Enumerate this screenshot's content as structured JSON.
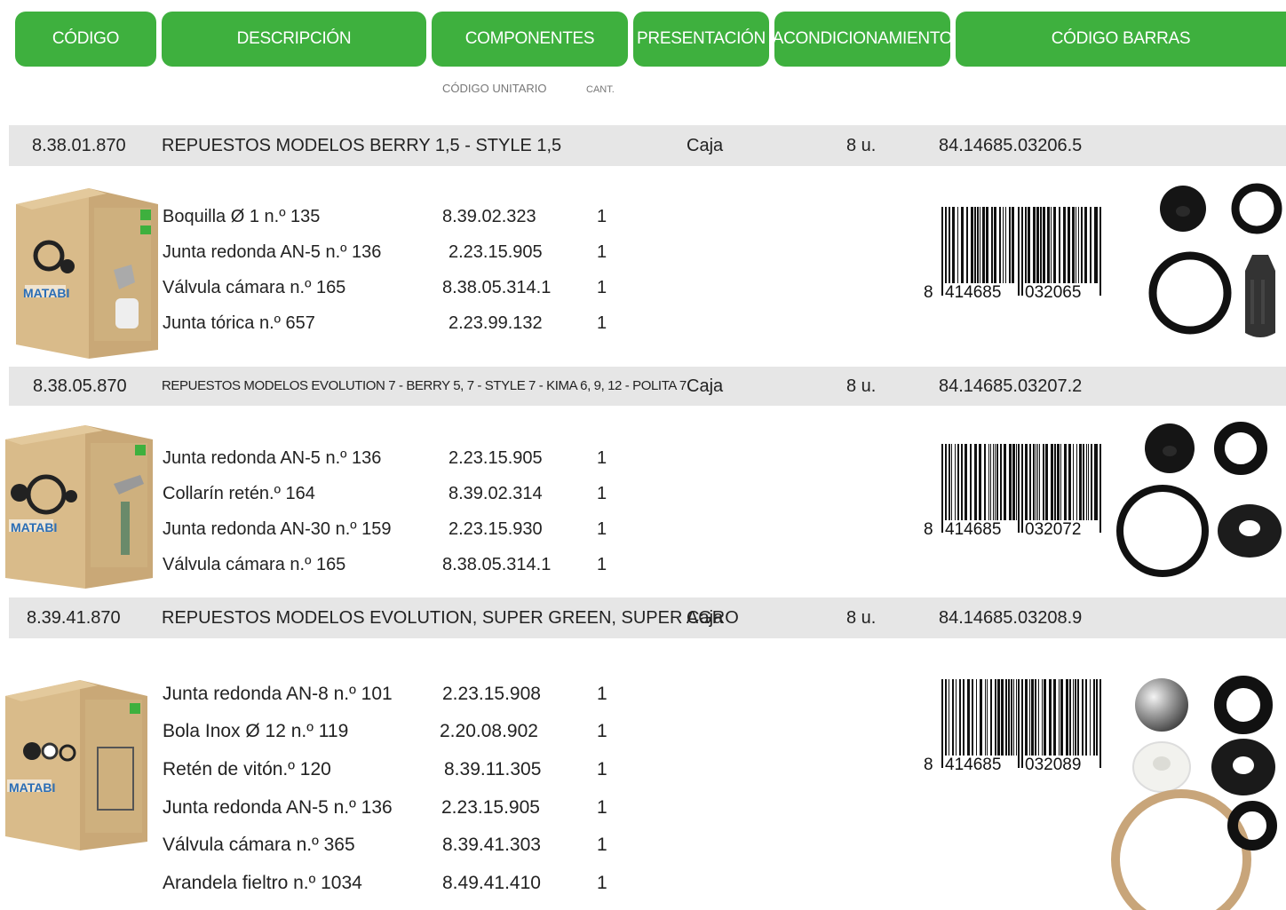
{
  "headers": {
    "codigo": "CÓDIGO",
    "descripcion": "DESCRIPCIÓN",
    "componentes": "COMPONENTES",
    "presentacion": "PRESENTACIÓN",
    "acondicionamiento": "ACONDICIONAMIENTO",
    "codigo_barras": "CÓDIGO BARRAS",
    "codigo_unitario": "CÓDIGO UNITARIO",
    "cant": "CANT."
  },
  "colors": {
    "accent": "#3eb03e",
    "band": "#e6e6e6",
    "box": "#c9a877"
  },
  "products": [
    {
      "code": "8.38.01.870",
      "description": "REPUESTOS MODELOS BERRY 1,5 - STYLE 1,5",
      "presentation": "Caja",
      "pack": "8 u.",
      "barcode": "84.14685.03206.5",
      "barcode_digits": {
        "first": "8",
        "left": "414685",
        "right": "032065"
      },
      "package_brand": "MATABI",
      "components": [
        {
          "name": "Boquilla Ø 1 n.º 135",
          "code": "8.39.02.323",
          "qty": "1"
        },
        {
          "name": "Junta redonda AN-5 n.º 136",
          "code": "2.23.15.905",
          "qty": "1"
        },
        {
          "name": "Válvula cámara n.º 165",
          "code": "8.38.05.314.1",
          "qty": "1"
        },
        {
          "name": "Junta tórica n.º 657",
          "code": "2.23.99.132",
          "qty": "1"
        }
      ]
    },
    {
      "code": "8.38.05.870",
      "description": "REPUESTOS MODELOS EVOLUTION 7 - BERRY 5, 7 - STYLE 7 - KIMA 6, 9, 12 - POLITA 7",
      "presentation": "Caja",
      "pack": "8 u.",
      "barcode": "84.14685.03207.2",
      "barcode_digits": {
        "first": "8",
        "left": "414685",
        "right": "032072"
      },
      "package_brand": "MATABI",
      "components": [
        {
          "name": "Junta redonda AN-5 n.º 136",
          "code": "2.23.15.905",
          "qty": "1"
        },
        {
          "name": "Collarín retén.º 164",
          "code": "8.39.02.314",
          "qty": "1"
        },
        {
          "name": "Junta redonda AN-30 n.º 159",
          "code": "2.23.15.930",
          "qty": "1"
        },
        {
          "name": "Válvula cámara n.º 165",
          "code": "8.38.05.314.1",
          "qty": "1"
        }
      ]
    },
    {
      "code": "8.39.41.870",
      "description": "REPUESTOS MODELOS EVOLUTION, SUPER GREEN, SUPER AGRO",
      "presentation": "Caja",
      "pack": "8 u.",
      "barcode": "84.14685.03208.9",
      "barcode_digits": {
        "first": "8",
        "left": "414685",
        "right": "032089"
      },
      "package_brand": "MATABI",
      "components": [
        {
          "name": "Junta redonda AN-8 n.º 101",
          "code": "2.23.15.908",
          "qty": "1"
        },
        {
          "name": "Bola Inox Ø 12 n.º 119",
          "code": "2.20.08.902",
          "qty": "1"
        },
        {
          "name": "Retén de vitón.º 120",
          "code": "8.39.11.305",
          "qty": "1"
        },
        {
          "name": "Junta redonda AN-5 n.º 136",
          "code": "2.23.15.905",
          "qty": "1"
        },
        {
          "name": "Válvula cámara n.º 365",
          "code": "8.39.41.303",
          "qty": "1"
        },
        {
          "name": "Arandela fieltro n.º 1034",
          "code": "8.49.41.410",
          "qty": "1"
        }
      ]
    }
  ]
}
